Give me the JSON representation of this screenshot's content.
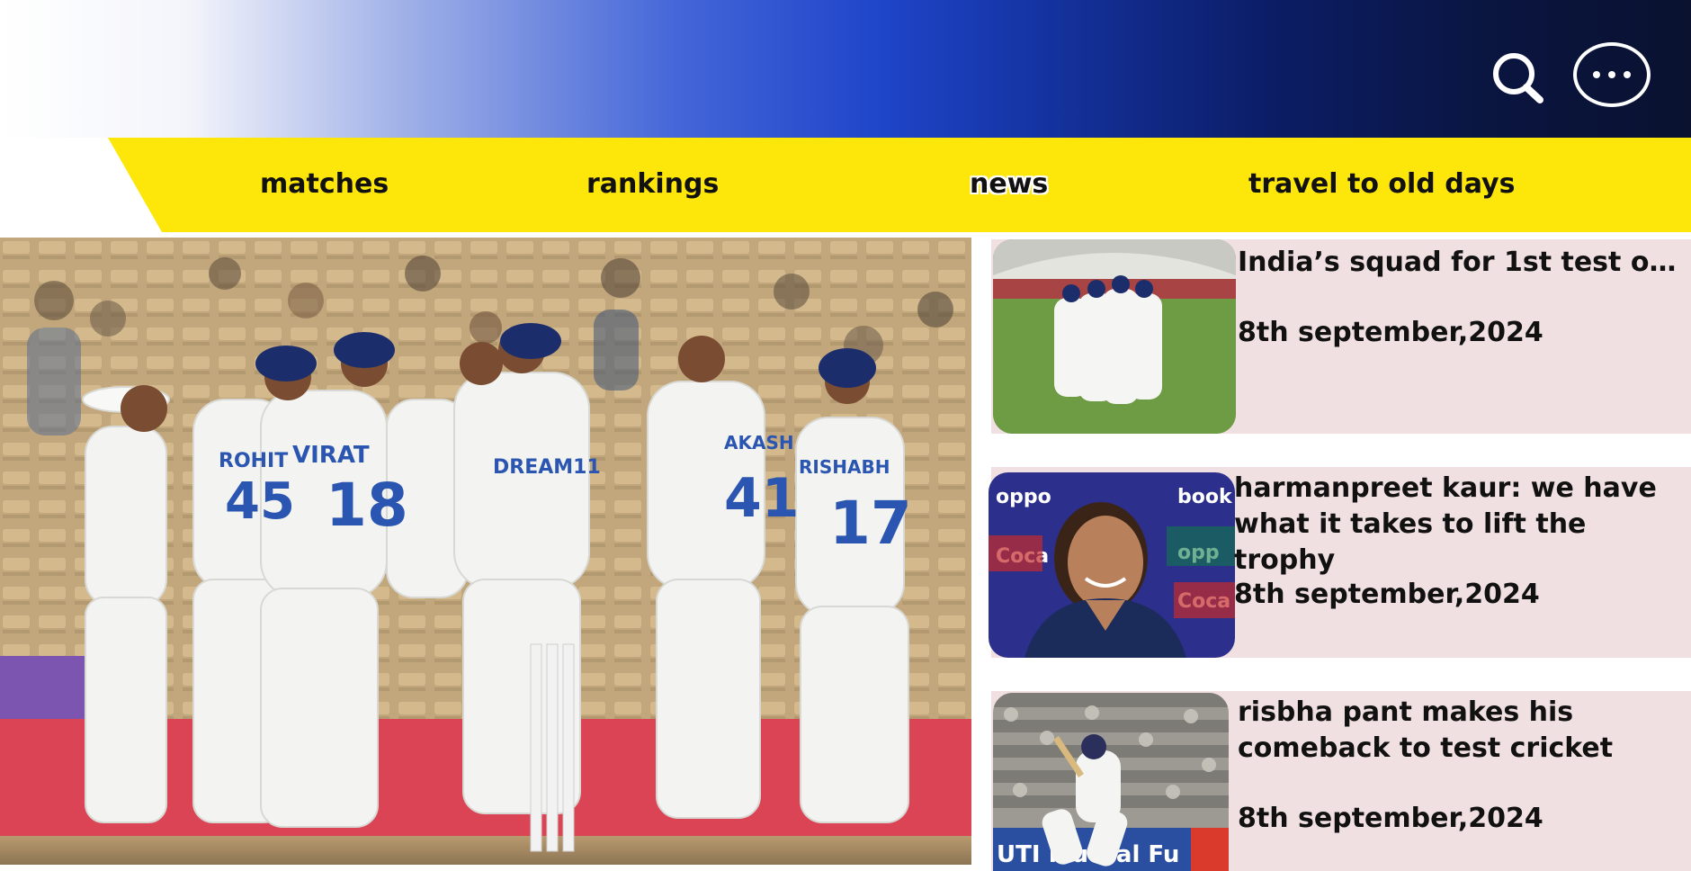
{
  "header": {
    "search_icon": "search-icon",
    "more_icon": "more-options-icon"
  },
  "nav": {
    "items": [
      {
        "label": "matches"
      },
      {
        "label": "rankings"
      },
      {
        "label": "news",
        "active": true
      },
      {
        "label": "travel to old days"
      }
    ]
  },
  "hero": {
    "image": "team-celebration-photo",
    "jersey_names": [
      "ROHIT",
      "VIRAT",
      "AKASH",
      "RISHABH"
    ],
    "jersey_numbers": [
      "45",
      "18",
      "41",
      "17"
    ],
    "sponsor": "DREAM11"
  },
  "news": {
    "items": [
      {
        "title": "India’s squad for 1st test of …",
        "date": "8th september,2024",
        "image": "team-huddle-photo"
      },
      {
        "title": "harmanpreet kaur: we have what it takes to lift the trophy",
        "date": "8th september,2024",
        "image": "press-conference-photo"
      },
      {
        "title": "risbha pant makes his comeback to test cricket",
        "date": "8th september,2024",
        "image": "batting-photo"
      }
    ]
  },
  "colors": {
    "nav_yellow": "#fde60a",
    "card_bg": "#f1e0e1",
    "header_dark": "#0a1230",
    "header_blue": "#1f45c9"
  }
}
